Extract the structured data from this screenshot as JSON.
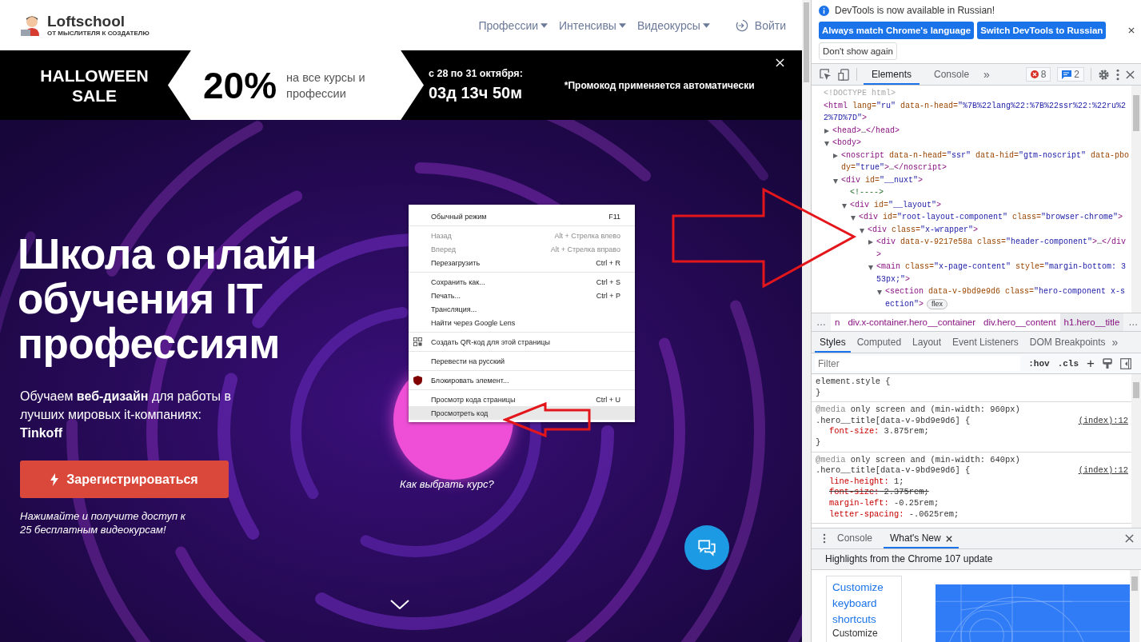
{
  "site": {
    "logo": {
      "name": "Loftschool",
      "tagline": "ОТ МЫСЛИТЕЛЯ К СОЗДАТЕЛЮ"
    },
    "nav": [
      {
        "label": "Профессии",
        "dropdown": true
      },
      {
        "label": "Интенсивы",
        "dropdown": true
      },
      {
        "label": "Видеокурсы",
        "dropdown": true
      }
    ],
    "login": "Войти",
    "banner": {
      "title": "HALLOWEEN SALE",
      "discount": "20%",
      "discount_note": "на все курсы и профессии",
      "dates": "с 28 по 31 октября:",
      "countdown": "03д 13ч 50м",
      "promo": "*Промокод применяется автоматически"
    },
    "hero": {
      "title": "Школа онлайн обучения IT профессиям",
      "subtitle": "Обучаем **веб-дизайн** для работы в лучших мировых it-компаниях: **Tinkoff**",
      "cta": "Зарегистрироваться",
      "note": "Нажимайте и получите доступ к 25 бесплатным видеокурсам!",
      "course_link": "Как выбрать курс?"
    },
    "context_menu": {
      "groups": [
        {
          "items": [
            {
              "kind": "plain",
              "label": "Обычный режим",
              "shortcut": "F11",
              "disabled": false,
              "selected": false
            }
          ]
        },
        {
          "items": [
            {
              "label": "Назад",
              "shortcut": "Alt + Стрелка влево",
              "disabled": true,
              "selected": false
            },
            {
              "label": "Вперед",
              "shortcut": "Alt + Стрелка вправо",
              "disabled": true,
              "selected": false
            },
            {
              "label": "Перезагрузить",
              "shortcut": "Ctrl + R",
              "disabled": false,
              "selected": false
            }
          ]
        },
        {
          "items": [
            {
              "label": "Сохранить как...",
              "shortcut": "Ctrl + S",
              "disabled": false,
              "selected": false
            },
            {
              "label": "Печать...",
              "shortcut": "Ctrl + P",
              "disabled": false,
              "selected": false
            },
            {
              "label": "Трансляция...",
              "disabled": false,
              "selected": false
            },
            {
              "label": "Найти через Google Lens",
              "disabled": false,
              "selected": false
            }
          ]
        },
        {
          "items": [
            {
              "kind": "qr",
              "label": "Создать QR-код для этой страницы",
              "disabled": false,
              "selected": false
            }
          ]
        },
        {
          "items": [
            {
              "label": "Перевести на русский",
              "disabled": false,
              "selected": false
            }
          ]
        },
        {
          "items": [
            {
              "kind": "shield",
              "label": "Блокировать элемент...",
              "disabled": false,
              "selected": false
            }
          ]
        },
        {
          "items": [
            {
              "label": "Просмотр кода страницы",
              "shortcut": "Ctrl + U",
              "disabled": false,
              "selected": false
            },
            {
              "label": "Просмотреть код",
              "disabled": false,
              "selected": true
            }
          ]
        }
      ]
    }
  },
  "devtools": {
    "infobar": {
      "message": "DevTools is now available in Russian!",
      "buttons": [
        "Always match Chrome's language",
        "Switch DevTools to Russian"
      ],
      "dismiss": "Don't show again"
    },
    "tabs": [
      {
        "label": "Elements",
        "selected": true
      },
      {
        "label": "Console",
        "selected": false
      }
    ],
    "more_tabs": "»",
    "errors": "8",
    "messages": "2",
    "elements": {
      "nodes": [
        {
          "parts": [
            {
              "kind": "doctype",
              "text": "<!DOCTYPE html>"
            }
          ]
        },
        {
          "parts": [
            {
              "kind": "tag",
              "text": "<html"
            },
            {
              "kind": "attr",
              "text": " lang="
            },
            {
              "kind": "value",
              "text": "\"ru\""
            },
            {
              "kind": "attr",
              "text": " data-n-head="
            },
            {
              "kind": "value",
              "text": "\"%7B%22lang%22:%7B%22ssr%22:%22ru%22%7D%7D\""
            },
            {
              "kind": "tag",
              "text": ">"
            }
          ],
          "children": [
            {
              "expanded": false,
              "parts": [
                {
                  "kind": "tag",
                  "text": "<head>"
                },
                {
                  "kind": "plain",
                  "text": "…"
                },
                {
                  "kind": "tag",
                  "text": "</head>"
                }
              ]
            },
            {
              "expanded": true,
              "parts": [
                {
                  "kind": "tag",
                  "text": "<body>"
                }
              ],
              "children": [
                {
                  "expanded": false,
                  "parts": [
                    {
                      "kind": "tag",
                      "text": "<noscript"
                    },
                    {
                      "kind": "attr",
                      "text": " data-n-head="
                    },
                    {
                      "kind": "value",
                      "text": "\"ssr\""
                    },
                    {
                      "kind": "attr",
                      "text": " data-hid="
                    },
                    {
                      "kind": "value",
                      "text": "\"gtm-noscript\""
                    },
                    {
                      "kind": "attr",
                      "text": " data-pbody="
                    },
                    {
                      "kind": "value",
                      "text": "\"true\""
                    },
                    {
                      "kind": "tag",
                      "text": ">"
                    },
                    {
                      "kind": "plain",
                      "text": "…"
                    },
                    {
                      "kind": "tag",
                      "text": "</noscript>"
                    }
                  ]
                },
                {
                  "expanded": true,
                  "parts": [
                    {
                      "kind": "tag",
                      "text": "<div"
                    },
                    {
                      "kind": "attr",
                      "text": " id="
                    },
                    {
                      "kind": "value",
                      "text": "\"__nuxt\""
                    },
                    {
                      "kind": "tag",
                      "text": ">"
                    }
                  ],
                  "children": [
                    {
                      "parts": [
                        {
                          "kind": "comment",
                          "text": "<!---->"
                        }
                      ]
                    },
                    {
                      "expanded": true,
                      "parts": [
                        {
                          "kind": "tag",
                          "text": "<div"
                        },
                        {
                          "kind": "attr",
                          "text": " id="
                        },
                        {
                          "kind": "value",
                          "text": "\"__layout\""
                        },
                        {
                          "kind": "tag",
                          "text": ">"
                        }
                      ],
                      "children": [
                        {
                          "expanded": true,
                          "parts": [
                            {
                              "kind": "tag",
                              "text": "<div"
                            },
                            {
                              "kind": "attr",
                              "text": " id="
                            },
                            {
                              "kind": "value",
                              "text": "\"root-layout-component\""
                            },
                            {
                              "kind": "attr",
                              "text": " class="
                            },
                            {
                              "kind": "value",
                              "text": "\"browser-chrome\""
                            },
                            {
                              "kind": "tag",
                              "text": ">"
                            }
                          ],
                          "children": [
                            {
                              "expanded": true,
                              "parts": [
                                {
                                  "kind": "tag",
                                  "text": "<div"
                                },
                                {
                                  "kind": "attr",
                                  "text": " class="
                                },
                                {
                                  "kind": "value",
                                  "text": "\"x-wrapper\""
                                },
                                {
                                  "kind": "tag",
                                  "text": ">"
                                }
                              ],
                              "children": [
                                {
                                  "expanded": false,
                                  "parts": [
                                    {
                                      "kind": "tag",
                                      "text": "<div"
                                    },
                                    {
                                      "kind": "attr",
                                      "text": " data-v-9217e58a class="
                                    },
                                    {
                                      "kind": "value",
                                      "text": "\"header-component\""
                                    },
                                    {
                                      "kind": "tag",
                                      "text": ">"
                                    },
                                    {
                                      "kind": "plain",
                                      "text": "…"
                                    },
                                    {
                                      "kind": "tag",
                                      "text": "</div>"
                                    }
                                  ]
                                },
                                {
                                  "expanded": true,
                                  "parts": [
                                    {
                                      "kind": "tag",
                                      "text": "<main"
                                    },
                                    {
                                      "kind": "attr",
                                      "text": " class="
                                    },
                                    {
                                      "kind": "value",
                                      "text": "\"x-page-content\""
                                    },
                                    {
                                      "kind": "attr",
                                      "text": " style="
                                    },
                                    {
                                      "kind": "value",
                                      "text": "\"margin-bottom: 353px;\""
                                    },
                                    {
                                      "kind": "tag",
                                      "text": ">"
                                    }
                                  ],
                                  "children": [
                                    {
                                      "expanded": true,
                                      "badge": "flex",
                                      "parts": [
                                        {
                                          "kind": "tag",
                                          "text": "<section"
                                        },
                                        {
                                          "kind": "attr",
                                          "text": " data-v-9bd9e9d6 class="
                                        },
                                        {
                                          "kind": "value",
                                          "text": "\"hero-component x-section\""
                                        },
                                        {
                                          "kind": "tag",
                                          "text": ">"
                                        }
                                      ]
                                    }
                                  ]
                                }
                              ]
                            }
                          ]
                        }
                      ]
                    }
                  ]
                }
              ]
            }
          ]
        }
      ]
    },
    "breadcrumbs": {
      "scroll_left": "…",
      "items": [
        {
          "label": "n",
          "selected": false
        },
        {
          "label": "div.x-container.hero__container",
          "selected": false
        },
        {
          "label": "div.hero__content",
          "selected": false
        },
        {
          "label": "h1.hero__title",
          "selected": true
        }
      ],
      "scroll_right": "…"
    },
    "side_tabs": [
      {
        "label": "Styles",
        "selected": true
      },
      {
        "label": "Computed",
        "selected": false
      },
      {
        "label": "Layout",
        "selected": false
      },
      {
        "label": "Event Listeners",
        "selected": false
      },
      {
        "label": "DOM Breakpoints",
        "selected": false
      }
    ],
    "side_more": "»",
    "filter": {
      "placeholder": "Filter",
      "hov": ":hov",
      "cls": ".cls",
      "add": "+"
    },
    "rules": [
      {
        "selector": "element.style {",
        "closing": "}"
      },
      {
        "media_keyword": "@media",
        "media_query": "only screen and (min-width: 960px)",
        "selector": ".hero__title[data-v-9bd9e9d6] {",
        "source": "(index):12",
        "declarations": [
          {
            "name": "font-size:",
            "value": "3.875rem;",
            "overridden": false
          }
        ],
        "closing": "}"
      },
      {
        "media_keyword": "@media",
        "media_query": "only screen and (min-width: 640px)",
        "selector": ".hero__title[data-v-9bd9e9d6] {",
        "source": "(index):12",
        "declarations": [
          {
            "name": "line-height:",
            "value": "1;",
            "overridden": false
          },
          {
            "name": "font-size:",
            "value": "2.375rem;",
            "overridden": true
          },
          {
            "name": "margin-left:",
            "value": "-0.25rem;",
            "overridden": false
          },
          {
            "name": "letter-spacing:",
            "value": "-.0625rem;",
            "overridden": false
          }
        ]
      }
    ],
    "drawer": {
      "tabs": [
        {
          "label": "Console",
          "selected": false,
          "closable": false
        },
        {
          "label": "What's New",
          "selected": true,
          "closable": true
        }
      ],
      "heading": "Highlights from the Chrome 107 update",
      "link": "Customize keyboard shortcuts",
      "next_item": "Customize"
    }
  }
}
